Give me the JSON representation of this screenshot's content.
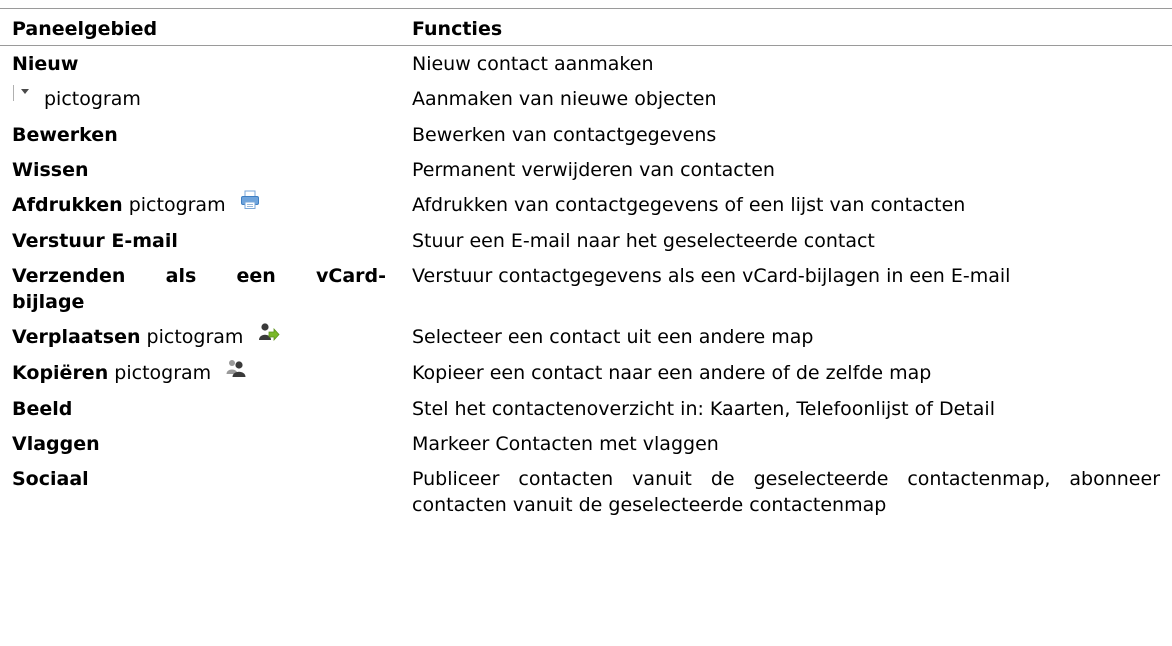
{
  "header": {
    "col_area": "Paneelgebied",
    "col_functions": "Functies"
  },
  "rows": [
    {
      "area_bold": "Nieuw",
      "area_rest": "",
      "icon": "",
      "function": "Nieuw contact aanmaken"
    },
    {
      "area_bold": "",
      "area_rest": "pictogram",
      "icon": "dropdown-arrow-icon",
      "function": "Aanmaken van nieuwe objecten"
    },
    {
      "area_bold": "Bewerken",
      "area_rest": "",
      "icon": "",
      "function": "Bewerken van contactgegevens"
    },
    {
      "area_bold": "Wissen",
      "area_rest": "",
      "icon": "",
      "function": "Permanent verwijderen van contacten"
    },
    {
      "area_bold": "Afdrukken",
      "area_rest": "pictogram",
      "icon": "printer-icon",
      "function": "Afdrukken van contactgegevens of een lijst van contacten"
    },
    {
      "area_bold": "Verstuur E-mail",
      "area_rest": "",
      "icon": "",
      "function": "Stuur een E-mail naar het geselecteerde contact"
    },
    {
      "area_bold_line1": "Verzenden als een vCard-",
      "area_bold_line2": "bijlage",
      "icon": "",
      "function": "Verstuur contactgegevens als een vCard-bijlagen in een E-mail"
    },
    {
      "area_bold": "Verplaatsen",
      "area_rest": "pictogram",
      "icon": "move-contact-icon",
      "function": "Selecteer een contact uit een andere map"
    },
    {
      "area_bold": "Kopiëren",
      "area_rest": "pictogram",
      "icon": "copy-contact-icon",
      "function": "Kopieer een contact naar een andere of de zelfde map"
    },
    {
      "area_bold": "Beeld",
      "area_rest": "",
      "icon": "",
      "function": "Stel het contactenoverzicht in: Kaarten, Telefoonlijst of Detail"
    },
    {
      "area_bold": "Vlaggen",
      "area_rest": "",
      "icon": "",
      "function": "Markeer Contacten met vlaggen"
    },
    {
      "area_bold": "Sociaal",
      "area_rest": "",
      "icon": "",
      "function": "Publiceer contacten vanuit de geselecteerde contactenmap, abonneer contacten vanuit de geselecteerde contactenmap"
    }
  ],
  "colors": {
    "rule": "#9a9a9a",
    "printer_blue": "#5b9bd5",
    "person_dark": "#3a3a3a",
    "move_green": "#7ab829"
  }
}
